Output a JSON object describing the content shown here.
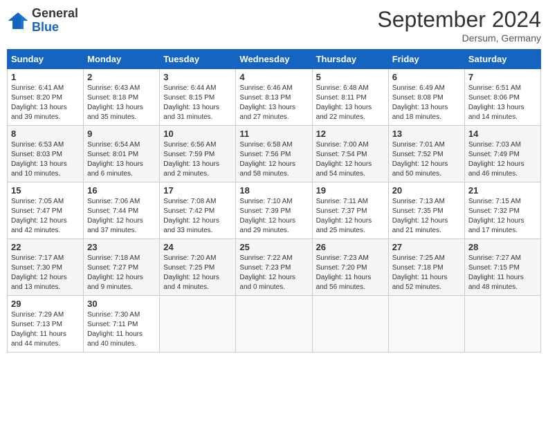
{
  "header": {
    "logo_general": "General",
    "logo_blue": "Blue",
    "title": "September 2024",
    "location": "Dersum, Germany"
  },
  "days_of_week": [
    "Sunday",
    "Monday",
    "Tuesday",
    "Wednesday",
    "Thursday",
    "Friday",
    "Saturday"
  ],
  "weeks": [
    [
      {
        "day": "1",
        "lines": [
          "Sunrise: 6:41 AM",
          "Sunset: 8:20 PM",
          "Daylight: 13 hours",
          "and 39 minutes."
        ]
      },
      {
        "day": "2",
        "lines": [
          "Sunrise: 6:43 AM",
          "Sunset: 8:18 PM",
          "Daylight: 13 hours",
          "and 35 minutes."
        ]
      },
      {
        "day": "3",
        "lines": [
          "Sunrise: 6:44 AM",
          "Sunset: 8:15 PM",
          "Daylight: 13 hours",
          "and 31 minutes."
        ]
      },
      {
        "day": "4",
        "lines": [
          "Sunrise: 6:46 AM",
          "Sunset: 8:13 PM",
          "Daylight: 13 hours",
          "and 27 minutes."
        ]
      },
      {
        "day": "5",
        "lines": [
          "Sunrise: 6:48 AM",
          "Sunset: 8:11 PM",
          "Daylight: 13 hours",
          "and 22 minutes."
        ]
      },
      {
        "day": "6",
        "lines": [
          "Sunrise: 6:49 AM",
          "Sunset: 8:08 PM",
          "Daylight: 13 hours",
          "and 18 minutes."
        ]
      },
      {
        "day": "7",
        "lines": [
          "Sunrise: 6:51 AM",
          "Sunset: 8:06 PM",
          "Daylight: 13 hours",
          "and 14 minutes."
        ]
      }
    ],
    [
      {
        "day": "8",
        "lines": [
          "Sunrise: 6:53 AM",
          "Sunset: 8:03 PM",
          "Daylight: 13 hours",
          "and 10 minutes."
        ]
      },
      {
        "day": "9",
        "lines": [
          "Sunrise: 6:54 AM",
          "Sunset: 8:01 PM",
          "Daylight: 13 hours",
          "and 6 minutes."
        ]
      },
      {
        "day": "10",
        "lines": [
          "Sunrise: 6:56 AM",
          "Sunset: 7:59 PM",
          "Daylight: 13 hours",
          "and 2 minutes."
        ]
      },
      {
        "day": "11",
        "lines": [
          "Sunrise: 6:58 AM",
          "Sunset: 7:56 PM",
          "Daylight: 12 hours",
          "and 58 minutes."
        ]
      },
      {
        "day": "12",
        "lines": [
          "Sunrise: 7:00 AM",
          "Sunset: 7:54 PM",
          "Daylight: 12 hours",
          "and 54 minutes."
        ]
      },
      {
        "day": "13",
        "lines": [
          "Sunrise: 7:01 AM",
          "Sunset: 7:52 PM",
          "Daylight: 12 hours",
          "and 50 minutes."
        ]
      },
      {
        "day": "14",
        "lines": [
          "Sunrise: 7:03 AM",
          "Sunset: 7:49 PM",
          "Daylight: 12 hours",
          "and 46 minutes."
        ]
      }
    ],
    [
      {
        "day": "15",
        "lines": [
          "Sunrise: 7:05 AM",
          "Sunset: 7:47 PM",
          "Daylight: 12 hours",
          "and 42 minutes."
        ]
      },
      {
        "day": "16",
        "lines": [
          "Sunrise: 7:06 AM",
          "Sunset: 7:44 PM",
          "Daylight: 12 hours",
          "and 37 minutes."
        ]
      },
      {
        "day": "17",
        "lines": [
          "Sunrise: 7:08 AM",
          "Sunset: 7:42 PM",
          "Daylight: 12 hours",
          "and 33 minutes."
        ]
      },
      {
        "day": "18",
        "lines": [
          "Sunrise: 7:10 AM",
          "Sunset: 7:39 PM",
          "Daylight: 12 hours",
          "and 29 minutes."
        ]
      },
      {
        "day": "19",
        "lines": [
          "Sunrise: 7:11 AM",
          "Sunset: 7:37 PM",
          "Daylight: 12 hours",
          "and 25 minutes."
        ]
      },
      {
        "day": "20",
        "lines": [
          "Sunrise: 7:13 AM",
          "Sunset: 7:35 PM",
          "Daylight: 12 hours",
          "and 21 minutes."
        ]
      },
      {
        "day": "21",
        "lines": [
          "Sunrise: 7:15 AM",
          "Sunset: 7:32 PM",
          "Daylight: 12 hours",
          "and 17 minutes."
        ]
      }
    ],
    [
      {
        "day": "22",
        "lines": [
          "Sunrise: 7:17 AM",
          "Sunset: 7:30 PM",
          "Daylight: 12 hours",
          "and 13 minutes."
        ]
      },
      {
        "day": "23",
        "lines": [
          "Sunrise: 7:18 AM",
          "Sunset: 7:27 PM",
          "Daylight: 12 hours",
          "and 9 minutes."
        ]
      },
      {
        "day": "24",
        "lines": [
          "Sunrise: 7:20 AM",
          "Sunset: 7:25 PM",
          "Daylight: 12 hours",
          "and 4 minutes."
        ]
      },
      {
        "day": "25",
        "lines": [
          "Sunrise: 7:22 AM",
          "Sunset: 7:23 PM",
          "Daylight: 12 hours",
          "and 0 minutes."
        ]
      },
      {
        "day": "26",
        "lines": [
          "Sunrise: 7:23 AM",
          "Sunset: 7:20 PM",
          "Daylight: 11 hours",
          "and 56 minutes."
        ]
      },
      {
        "day": "27",
        "lines": [
          "Sunrise: 7:25 AM",
          "Sunset: 7:18 PM",
          "Daylight: 11 hours",
          "and 52 minutes."
        ]
      },
      {
        "day": "28",
        "lines": [
          "Sunrise: 7:27 AM",
          "Sunset: 7:15 PM",
          "Daylight: 11 hours",
          "and 48 minutes."
        ]
      }
    ],
    [
      {
        "day": "29",
        "lines": [
          "Sunrise: 7:29 AM",
          "Sunset: 7:13 PM",
          "Daylight: 11 hours",
          "and 44 minutes."
        ]
      },
      {
        "day": "30",
        "lines": [
          "Sunrise: 7:30 AM",
          "Sunset: 7:11 PM",
          "Daylight: 11 hours",
          "and 40 minutes."
        ]
      },
      null,
      null,
      null,
      null,
      null
    ]
  ]
}
